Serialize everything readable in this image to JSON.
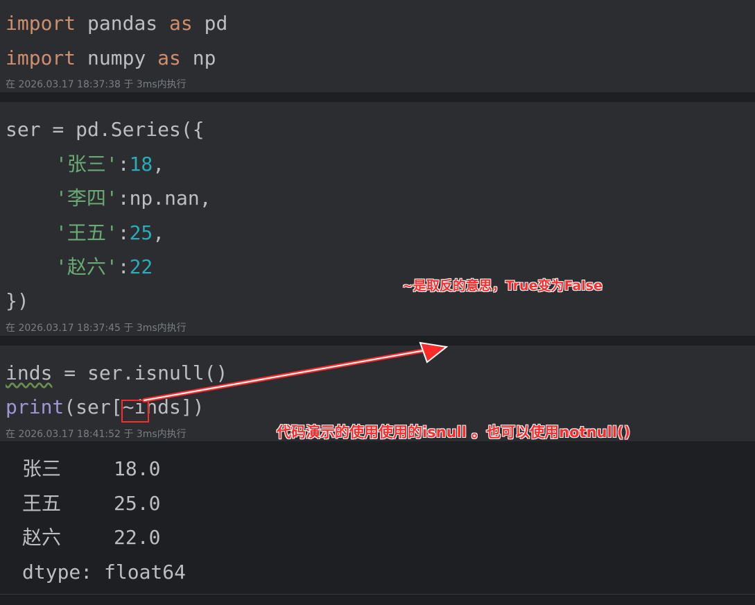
{
  "cells": [
    {
      "lines": [
        {
          "kw1": "import",
          "t1": " pandas ",
          "kw2": "as",
          "t2": " pd"
        },
        {
          "kw1": "import",
          "t1": " numpy ",
          "kw2": "as",
          "t2": " np"
        }
      ],
      "meta": "在 2026.03.17 18:37:38 于 3ms内执行"
    },
    {
      "line0": "ser = pd.Series({",
      "entries": [
        {
          "key": "'张三'",
          "sep": ":",
          "val": "18",
          "tail": ","
        },
        {
          "key": "'李四'",
          "sep": ":",
          "val": "np.nan",
          "tail": ","
        },
        {
          "key": "'王五'",
          "sep": ":",
          "val": "25",
          "tail": ","
        },
        {
          "key": "'赵六'",
          "sep": ":",
          "val": "22",
          "tail": ""
        }
      ],
      "close": "})",
      "meta": "在 2026.03.17 18:37:45 于 3ms内执行"
    },
    {
      "line1_var": "inds",
      "line1_rest": " = ser.isnull()",
      "line2_fn": "print",
      "line2_rest": "(ser[~inds])",
      "meta": "在 2026.03.17 18:41:52 于 3ms内执行"
    }
  ],
  "output": {
    "rows": [
      {
        "index": "张三",
        "value": "18.0"
      },
      {
        "index": "王五",
        "value": "25.0"
      },
      {
        "index": "赵六",
        "value": "22.0"
      }
    ],
    "dtype": "dtype: float64"
  },
  "annotations": {
    "tilde_note": "~是取反的意思，True变为False",
    "isnull_note": "代码演示的使用使用的isnull 。也可以使用notnull()"
  },
  "colors": {
    "keyword": "#cf8e6d",
    "string": "#6aab73",
    "number": "#2aacb8",
    "builtin": "#a295d6",
    "annotation": "#ff2a2a"
  }
}
